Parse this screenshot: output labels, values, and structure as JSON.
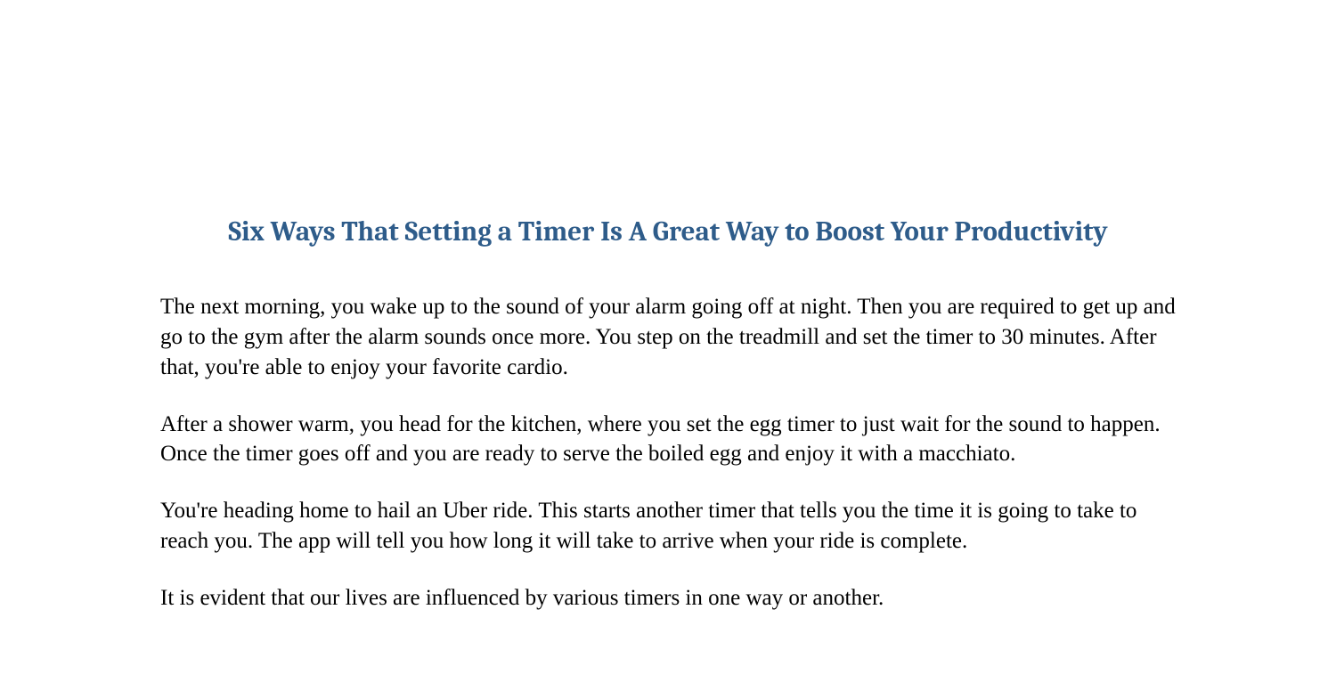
{
  "title": "Six Ways That Setting a Timer Is A Great Way to Boost Your Productivity",
  "paragraphs": {
    "p1": "The next morning, you wake up to the sound of your alarm going off at night. Then you are required to get up and go to the gym after the alarm sounds once more. You step on the treadmill and set the timer to 30 minutes. After that, you're able to enjoy your favorite cardio.",
    "p2": "After a shower warm, you head for the kitchen, where you set the egg timer to just wait for the sound to happen. Once the timer goes off and you are ready to serve the boiled egg and enjoy it with a macchiato.",
    "p3": "You're heading home to hail an Uber ride. This starts another timer that tells you the time it is going to take to reach you. The app will tell you how long it will take to arrive when your ride is complete.",
    "p4": "It is evident that our lives are influenced by various timers in one way or another."
  }
}
